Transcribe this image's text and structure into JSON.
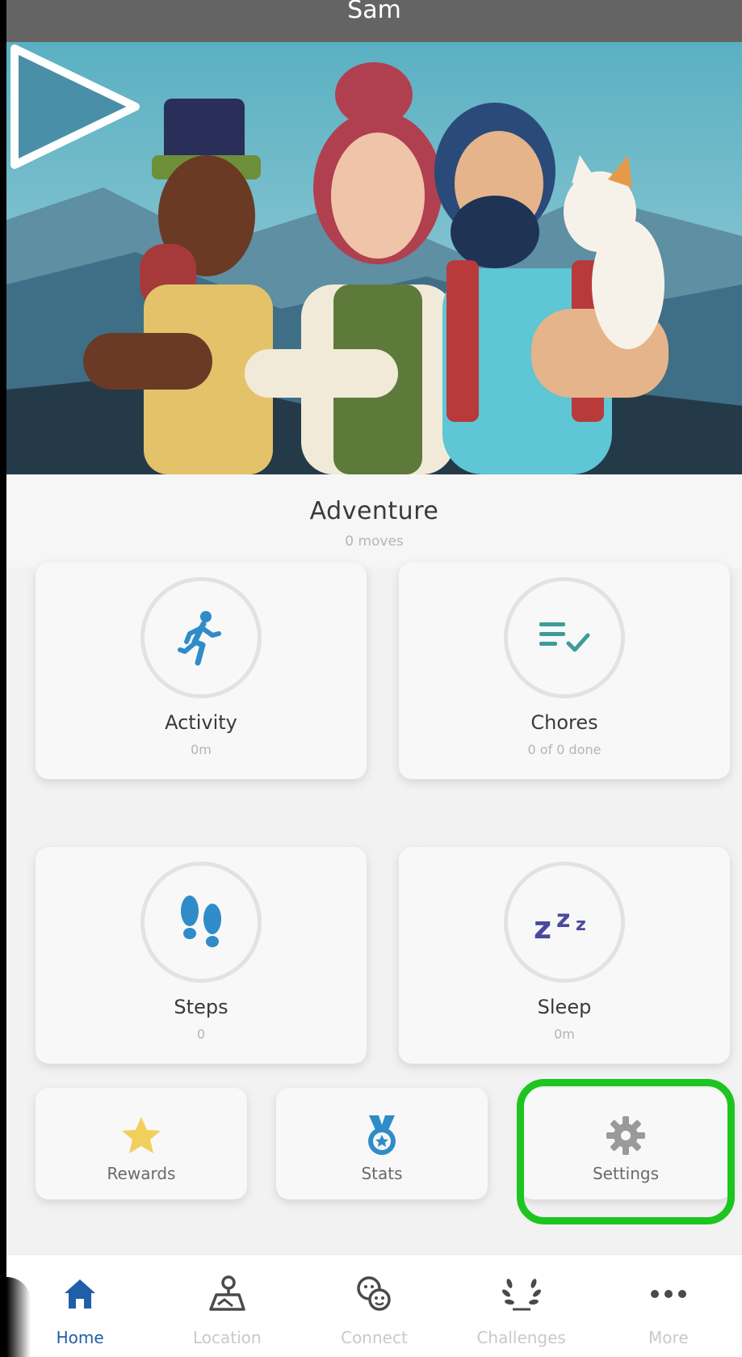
{
  "header": {
    "title": "Sam"
  },
  "adventure": {
    "title": "Adventure",
    "subtitle": "0 moves"
  },
  "cards": {
    "activity": {
      "label": "Activity",
      "value": "0m",
      "icon": "running-person-icon"
    },
    "chores": {
      "label": "Chores",
      "value": "0 of 0 done",
      "icon": "checklist-icon"
    },
    "steps": {
      "label": "Steps",
      "value": "0",
      "icon": "footprints-icon"
    },
    "sleep": {
      "label": "Sleep",
      "value": "0m",
      "icon": "zzz-icon"
    }
  },
  "quick_actions": {
    "rewards": {
      "label": "Rewards",
      "icon": "star-icon"
    },
    "stats": {
      "label": "Stats",
      "icon": "medal-icon"
    },
    "settings": {
      "label": "Settings",
      "icon": "gear-icon"
    }
  },
  "nav": {
    "items": [
      {
        "label": "Home",
        "icon": "home-icon",
        "active": true
      },
      {
        "label": "Location",
        "icon": "map-pin-icon",
        "active": false
      },
      {
        "label": "Connect",
        "icon": "connect-faces-icon",
        "active": false
      },
      {
        "label": "Challenges",
        "icon": "laurel-icon",
        "active": false
      },
      {
        "label": "More",
        "icon": "more-dots-icon",
        "active": false
      }
    ]
  },
  "colors": {
    "accent_blue": "#2f8cc8",
    "nav_active": "#1f5ea8",
    "sleep_purple": "#4a4a9c",
    "chores_teal": "#3e9b9b",
    "star_yellow": "#f1cf5c",
    "highlight_green": "#1ec51e"
  }
}
